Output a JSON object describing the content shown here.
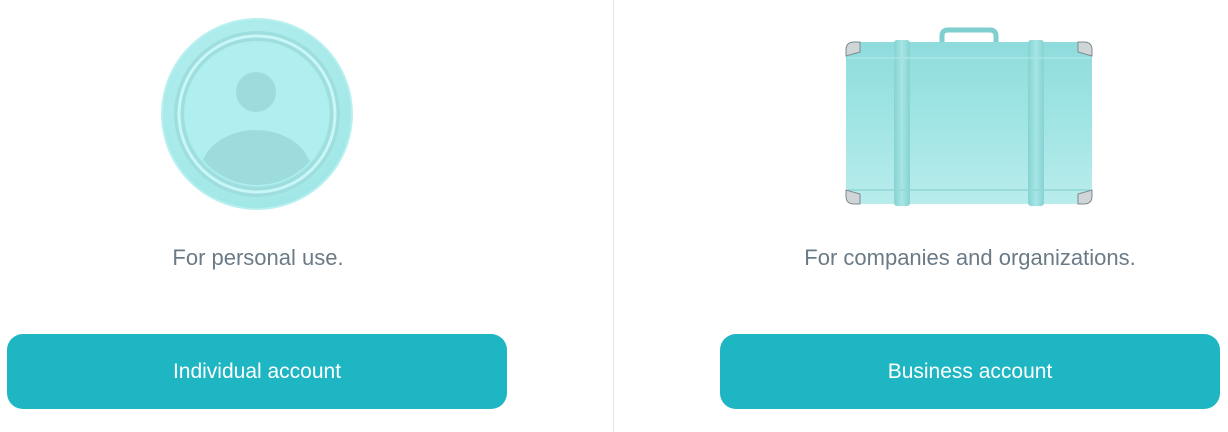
{
  "individual": {
    "icon": "person-avatar-icon",
    "description": "For personal use.",
    "button_label": "Individual account"
  },
  "business": {
    "icon": "suitcase-icon",
    "description": "For companies and organizations.",
    "button_label": "Business account"
  },
  "colors": {
    "accent": "#1eb6c3",
    "text_muted": "#6a7b87",
    "icon_fill": "#aeeeed"
  }
}
